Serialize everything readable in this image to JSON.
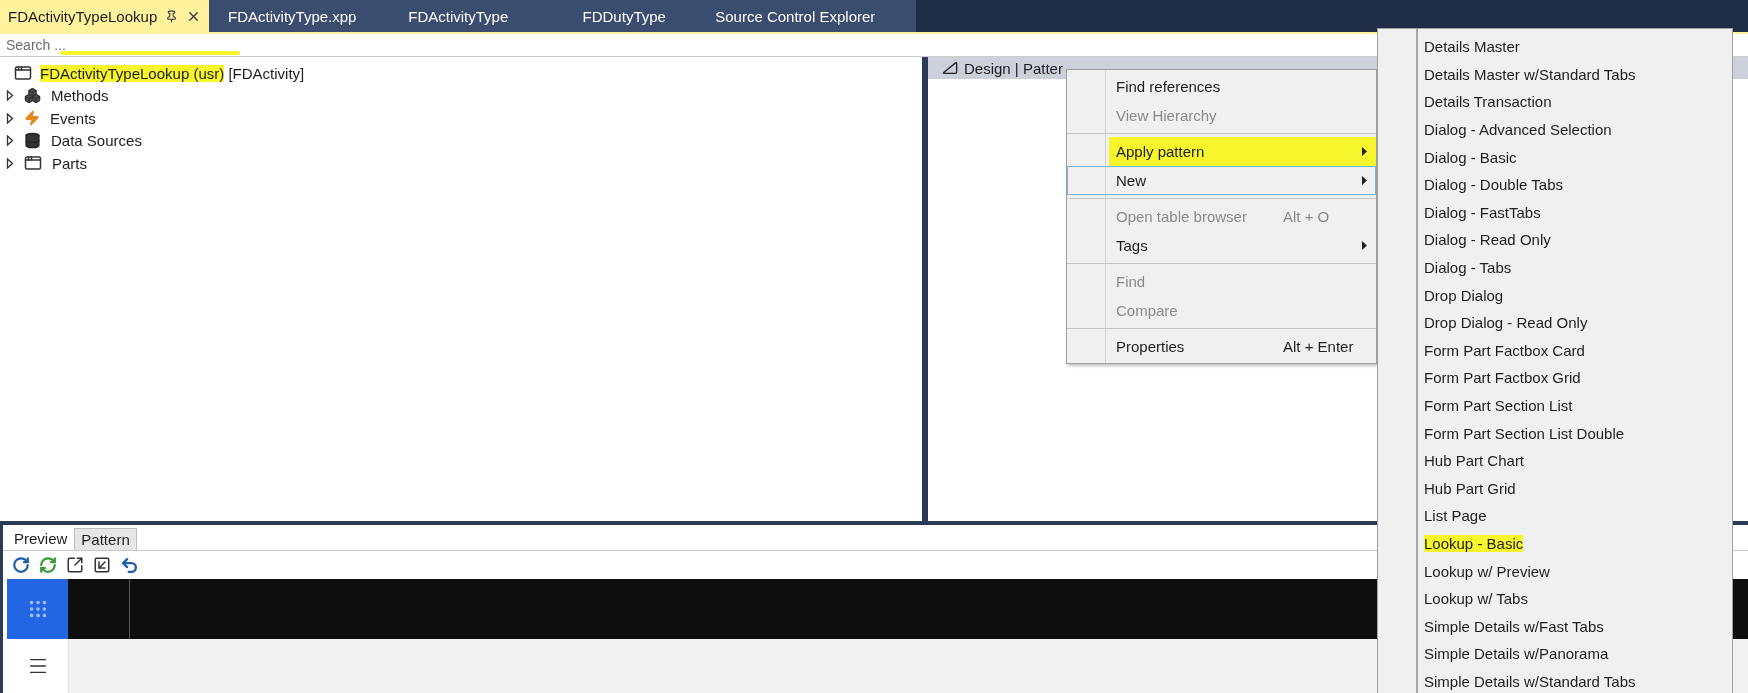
{
  "tabs": [
    {
      "label": "FDActivityTypeLookup",
      "selected": true
    },
    {
      "label": "FDActivityType.xpp",
      "selected": false
    },
    {
      "label": "FDActivityType",
      "selected": false
    },
    {
      "label": "FDDutyType",
      "selected": false
    },
    {
      "label": "Source Control Explorer",
      "selected": false
    }
  ],
  "search": {
    "placeholder": "Search ...",
    "highlighted": true
  },
  "tree": {
    "root": {
      "label": "FDActivityTypeLookup (usr)",
      "suffix": "[FDActivity]",
      "highlighted": true
    },
    "children": [
      {
        "label": "Methods",
        "kind": "methods",
        "expanded": false
      },
      {
        "label": "Events",
        "kind": "events",
        "expanded": false
      },
      {
        "label": "Data Sources",
        "kind": "datasources",
        "expanded": false
      },
      {
        "label": "Parts",
        "kind": "parts",
        "expanded": false
      }
    ]
  },
  "design_header": {
    "label": "Design | Patter"
  },
  "context_menu": [
    {
      "kind": "item",
      "label": "Find references",
      "disabled": false
    },
    {
      "kind": "item",
      "label": "View Hierarchy",
      "disabled": true
    },
    {
      "kind": "separator"
    },
    {
      "kind": "item",
      "label": "Apply pattern",
      "disabled": false,
      "submenu": true,
      "highlighted": true
    },
    {
      "kind": "item",
      "label": "New",
      "disabled": false,
      "submenu": true,
      "focused": true
    },
    {
      "kind": "separator"
    },
    {
      "kind": "item",
      "label": "Open table browser",
      "disabled": true,
      "shortcut": "Alt + O"
    },
    {
      "kind": "item",
      "label": "Tags",
      "disabled": false,
      "submenu": true
    },
    {
      "kind": "separator"
    },
    {
      "kind": "item",
      "label": "Find",
      "disabled": true
    },
    {
      "kind": "item",
      "label": "Compare",
      "disabled": true
    },
    {
      "kind": "separator"
    },
    {
      "kind": "item",
      "label": "Properties",
      "disabled": false,
      "shortcut": "Alt + Enter"
    }
  ],
  "pattern_submenu": [
    {
      "label": "Details Master",
      "highlighted": false
    },
    {
      "label": "Details Master w/Standard Tabs",
      "highlighted": false
    },
    {
      "label": "Details Transaction",
      "highlighted": false
    },
    {
      "label": "Dialog - Advanced Selection",
      "highlighted": false
    },
    {
      "label": "Dialog - Basic",
      "highlighted": false
    },
    {
      "label": "Dialog - Double Tabs",
      "highlighted": false
    },
    {
      "label": "Dialog - FastTabs",
      "highlighted": false
    },
    {
      "label": "Dialog - Read Only",
      "highlighted": false
    },
    {
      "label": "Dialog - Tabs",
      "highlighted": false
    },
    {
      "label": "Drop Dialog",
      "highlighted": false
    },
    {
      "label": "Drop Dialog - Read Only",
      "highlighted": false
    },
    {
      "label": "Form Part Factbox Card",
      "highlighted": false
    },
    {
      "label": "Form Part Factbox Grid",
      "highlighted": false
    },
    {
      "label": "Form Part Section List",
      "highlighted": false
    },
    {
      "label": "Form Part Section List Double",
      "highlighted": false
    },
    {
      "label": "Hub Part Chart",
      "highlighted": false
    },
    {
      "label": "Hub Part Grid",
      "highlighted": false
    },
    {
      "label": "List Page",
      "highlighted": false
    },
    {
      "label": "Lookup - Basic",
      "highlighted": true
    },
    {
      "label": "Lookup w/ Preview",
      "highlighted": false
    },
    {
      "label": "Lookup w/ Tabs",
      "highlighted": false
    },
    {
      "label": "Simple Details w/Fast Tabs",
      "highlighted": false
    },
    {
      "label": "Simple Details w/Panorama",
      "highlighted": false
    },
    {
      "label": "Simple Details w/Standard Tabs",
      "highlighted": false
    }
  ],
  "bottom_tabs": [
    {
      "label": "Preview",
      "selected": true
    },
    {
      "label": "Pattern",
      "selected": false
    }
  ]
}
